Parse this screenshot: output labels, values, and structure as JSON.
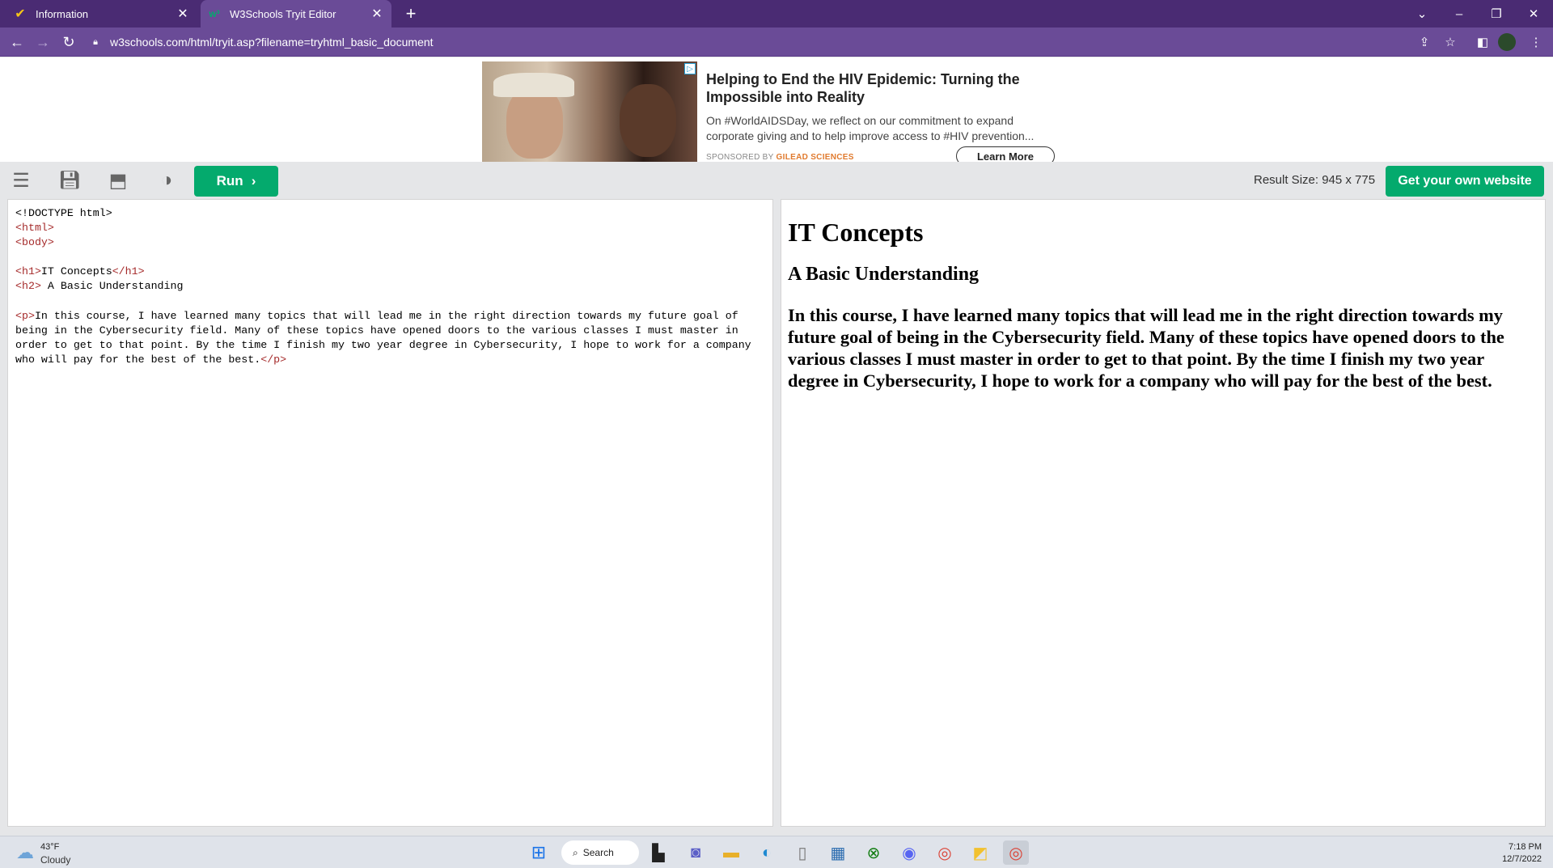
{
  "browser": {
    "tabs": [
      {
        "title": "Information",
        "icon": "app-icon"
      },
      {
        "title": "W3Schools Tryit Editor",
        "icon": "w3schools-icon"
      }
    ],
    "url": "w3schools.com/html/tryit.asp?filename=tryhtml_basic_document"
  },
  "ad": {
    "headline": "Helping to End the HIV Epidemic: Turning the Impossible into Reality",
    "body": "On #WorldAIDSDay, we reflect on our commitment to expand\ncorporate giving and to help improve access to #HIV prevention...",
    "sponsored_prefix": "SPONSORED BY",
    "sponsor": "GILEAD SCIENCES",
    "cta": "Learn More"
  },
  "toolbar": {
    "run_label": "Run",
    "result_size": "Result Size: 945 x 775",
    "own_site_label": "Get your own website"
  },
  "code": {
    "doctype": "<!DOCTYPE html>",
    "html_open": "<html>",
    "body_open": "<body>",
    "h1_open": "<h1>",
    "h1_text": "IT Concepts",
    "h1_close": "</h1>",
    "h2_open": "<h2>",
    "h2_text": " A Basic Understanding",
    "p_open": "<p>",
    "p_text": "In this course, I have learned many topics that will lead me in the right direction towards my future goal of being in the Cybersecurity field. Many of these topics have opened doors to the various classes I must master in order to get to that point. By the time I finish my two year degree in Cybersecurity, I hope to work for a company who will pay for the best of the best.",
    "p_close": "</p>"
  },
  "result": {
    "h1": "IT Concepts",
    "h2": "A Basic Understanding",
    "p": "In this course, I have learned many topics that will lead me in the right direction towards my future goal of being in the Cybersecurity field. Many of these topics have opened doors to the various classes I must master in order to get to that point. By the time I finish my two year degree in Cybersecurity, I hope to work for a company who will pay for the best of the best."
  },
  "taskbar": {
    "temperature": "43°F",
    "weather": "Cloudy",
    "search_label": "Search",
    "time": "7:18 PM",
    "date": "12/7/2022"
  },
  "colors": {
    "tab_bar": "#4a2b73",
    "address_bar": "#6a4b97",
    "w3_green": "#04aa6d",
    "code_tag": "#a52a2a"
  }
}
